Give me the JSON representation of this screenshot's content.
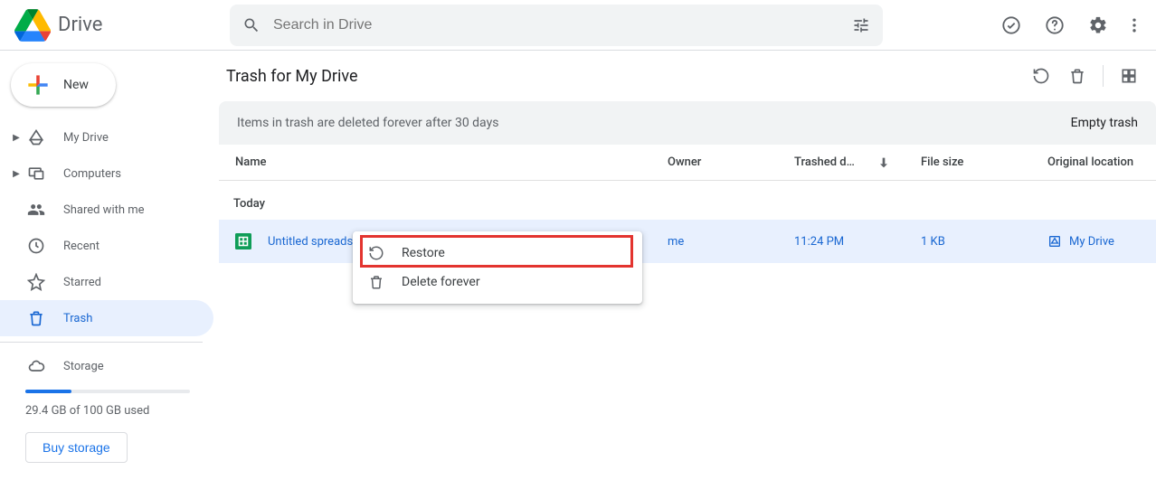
{
  "app": {
    "name": "Drive",
    "search_placeholder": "Search in Drive"
  },
  "sidebar": {
    "new_label": "New",
    "items": [
      {
        "label": "My Drive"
      },
      {
        "label": "Computers"
      },
      {
        "label": "Shared with me"
      },
      {
        "label": "Recent"
      },
      {
        "label": "Starred"
      },
      {
        "label": "Trash"
      }
    ],
    "storage_label": "Storage",
    "storage_used": "29.4 GB of 100 GB used",
    "buy_label": "Buy storage"
  },
  "page": {
    "title": "Trash for My Drive",
    "banner_text": "Items in trash are deleted forever after 30 days",
    "banner_action": "Empty trash"
  },
  "columns": {
    "name": "Name",
    "owner": "Owner",
    "trashed": "Trashed d…",
    "size": "File size",
    "location": "Original location"
  },
  "groups": [
    {
      "label": "Today"
    }
  ],
  "rows": [
    {
      "name": "Untitled spreadsheet",
      "owner": "me",
      "trashed": "11:24 PM",
      "size": "1 KB",
      "location": "My Drive"
    }
  ],
  "context_menu": {
    "restore": "Restore",
    "delete_forever": "Delete forever"
  }
}
